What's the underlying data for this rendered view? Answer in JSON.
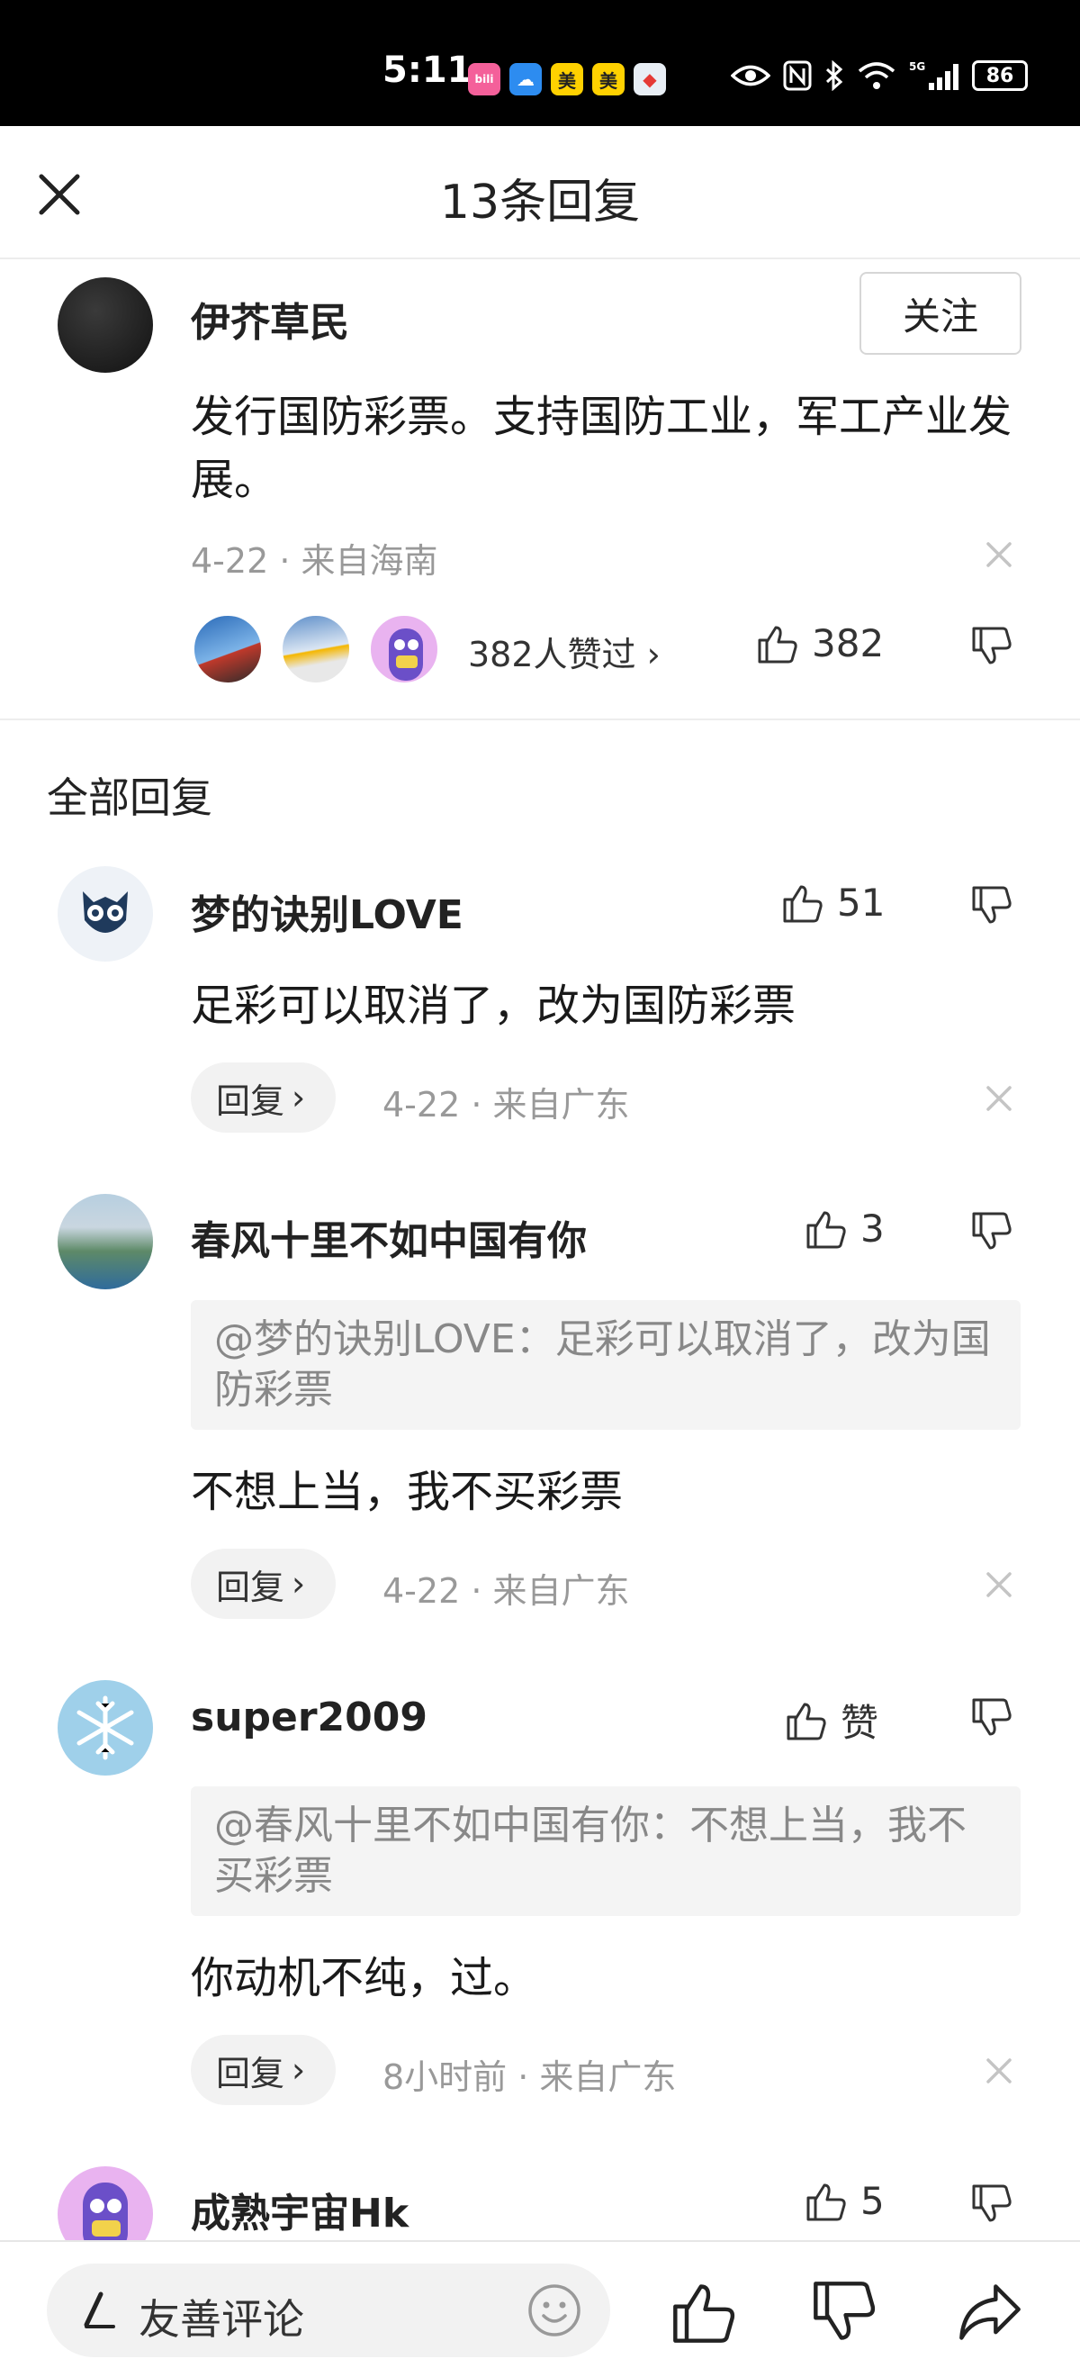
{
  "status_bar": {
    "time": "5:11",
    "battery": "86",
    "apps": [
      {
        "icon": "bilibili-app-icon",
        "glyph": "bili",
        "color": "#f4609a"
      },
      {
        "icon": "weather-app-icon",
        "glyph": "☁",
        "color": "#2d8cf0"
      },
      {
        "icon": "meituan-app-icon",
        "glyph": "美",
        "color": "#ffd100"
      },
      {
        "icon": "meituan-app-icon-2",
        "glyph": "美",
        "color": "#ffd100"
      },
      {
        "icon": "compass-app-icon",
        "glyph": "◆",
        "color": "#e8eef5"
      }
    ]
  },
  "header": {
    "title": "13条回复"
  },
  "main_comment": {
    "username": "伊芥草民",
    "follow_label": "关注",
    "text": "发行国防彩票。支持国防工业，军工产业发展。",
    "meta": "4-22 · 来自海南",
    "likes_summary": "382人赞过",
    "like_count": "382"
  },
  "section_title": "全部回复",
  "replies": [
    {
      "username": "梦的诀别LOVE",
      "like_count": "51",
      "text": "足彩可以取消了，改为国防彩票",
      "reply_label": "回复",
      "meta": "4-22 · 来自广东"
    },
    {
      "username": "春风十里不如中国有你",
      "like_count": "3",
      "quote": "@梦的诀别LOVE：足彩可以取消了，改为国防彩票",
      "text": "不想上当，我不买彩票",
      "reply_label": "回复",
      "meta": "4-22 · 来自广东"
    },
    {
      "username": "super2009",
      "like_count": "赞",
      "quote": "@春风十里不如中国有你：不想上当，我不买彩票",
      "text": "你动机不纯，过。",
      "reply_label": "回复",
      "meta": "8小时前 · 来自广东"
    },
    {
      "username": "成熟宇宙Hk",
      "like_count": "5"
    }
  ],
  "bottom_bar": {
    "placeholder": "友善评论"
  },
  "colors": {
    "text": "#222222",
    "meta": "#999999",
    "quote_bg": "#f4f4f4",
    "status_bar": "#000000"
  }
}
